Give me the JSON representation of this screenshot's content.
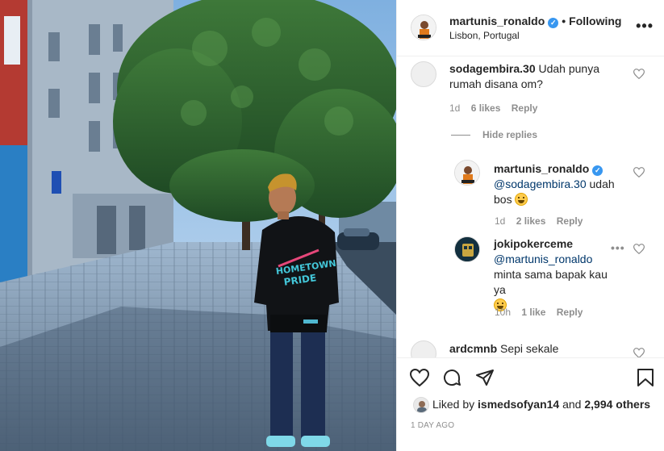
{
  "post": {
    "photo_alt": "Man in black hoodie standing on cobblestone street under trees",
    "hoodie_print": "HOMETOWN PRIDE"
  },
  "header": {
    "username": "martunis_ronaldo",
    "verified_mark": "✓",
    "separator": "•",
    "follow_label": "Following",
    "location": "Lisbon, Portugal",
    "more_label": "•••"
  },
  "comments": [
    {
      "username": "sodagembira.30",
      "text": "Udah punya rumah disana om?",
      "time": "1d",
      "likes": "6 likes",
      "reply_label": "Reply",
      "hide_replies_label": "Hide replies",
      "replies": [
        {
          "username": "martunis_ronaldo",
          "verified_mark": "✓",
          "mention": "@sodagembira.30",
          "text": "udah bos",
          "time": "1d",
          "likes": "2 likes",
          "reply_label": "Reply"
        },
        {
          "username": "jokipokerceme",
          "mention": "@martunis_ronaldo",
          "text": "minta sama bapak kau ya",
          "time": "10h",
          "likes": "1 like",
          "reply_label": "Reply",
          "more_label": "•••"
        }
      ]
    },
    {
      "username": "ardcmnb",
      "text": "Sepi sekale"
    }
  ],
  "actions": {
    "liked_by_prefix": "Liked by",
    "liked_by_user": "ismedsofyan14",
    "and_label": "and",
    "others_label": "2,994 others",
    "posted_ago": "1 DAY AGO"
  },
  "colors": {
    "verified": "#3897f0",
    "mention": "#00376b",
    "secondary_text": "#8e8e8e",
    "border": "#efefef"
  }
}
